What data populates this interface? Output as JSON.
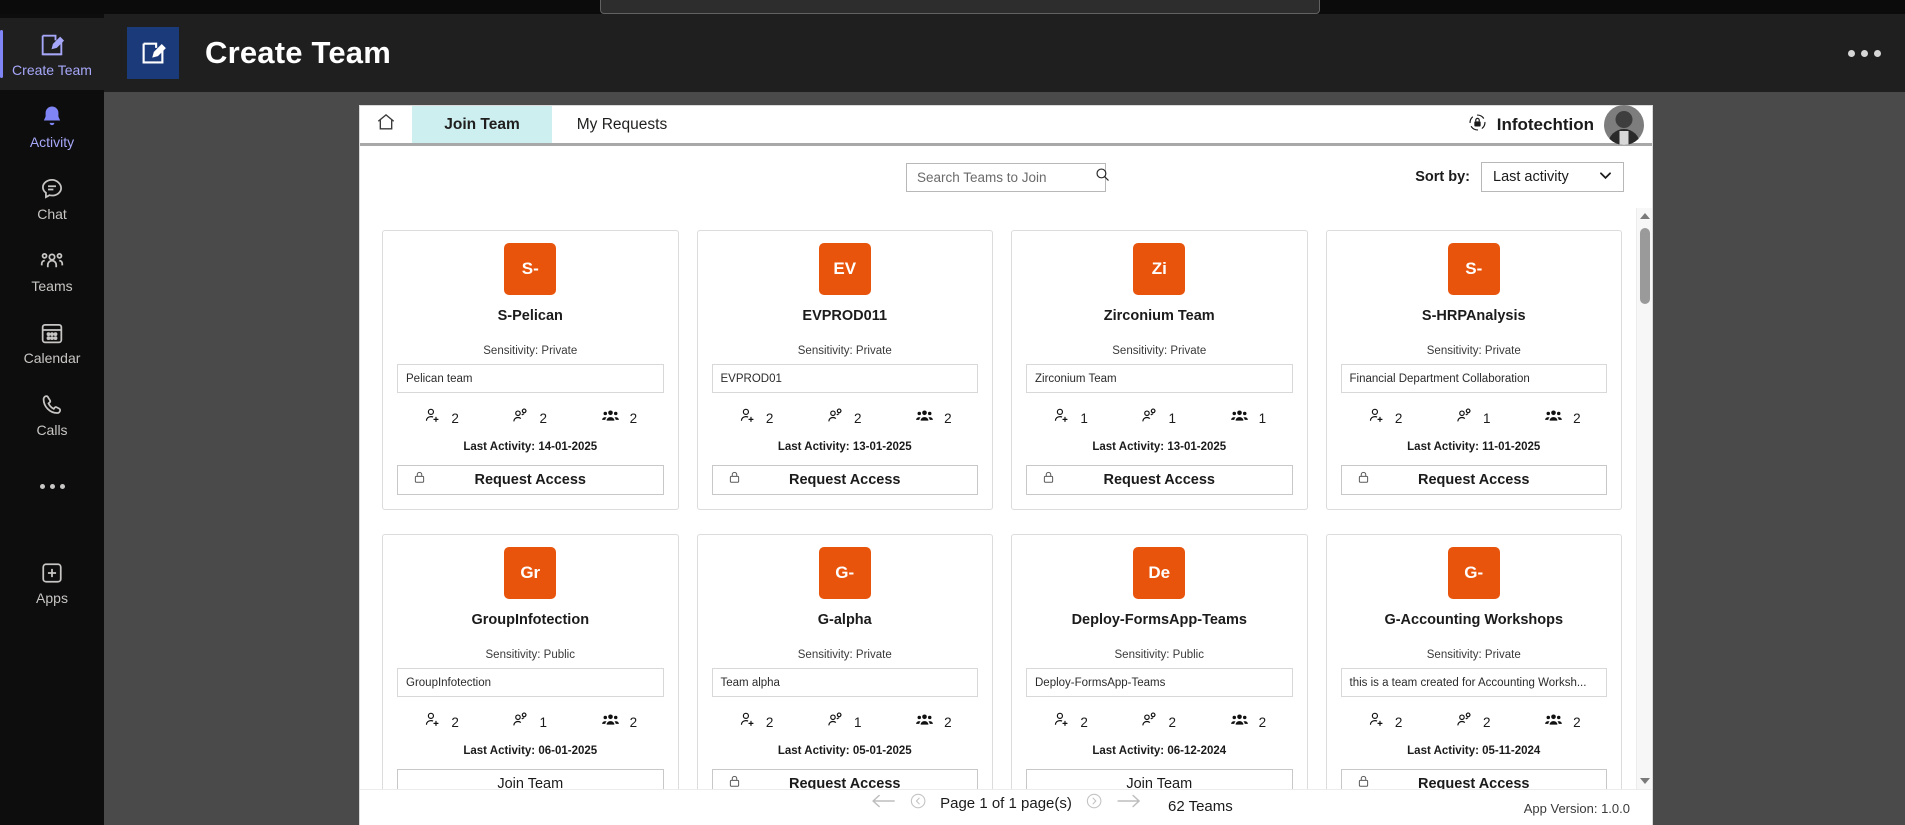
{
  "rail": {
    "items": [
      {
        "label": "Create Team",
        "icon": "compose-icon",
        "state": "active"
      },
      {
        "label": "Activity",
        "icon": "bell-icon",
        "state": "highlight"
      },
      {
        "label": "Chat",
        "icon": "chat-icon",
        "state": "normal"
      },
      {
        "label": "Teams",
        "icon": "teams-icon",
        "state": "normal"
      },
      {
        "label": "Calendar",
        "icon": "calendar-icon",
        "state": "normal"
      },
      {
        "label": "Calls",
        "icon": "phone-icon",
        "state": "normal"
      },
      {
        "label": "",
        "icon": "more-dots-icon",
        "state": "normal"
      },
      {
        "label": "Apps",
        "icon": "apps-plus-icon",
        "state": "normal"
      }
    ]
  },
  "app_header": {
    "title": "Create Team",
    "icon": "compose-app-icon",
    "overflow": "more-options-icon",
    "accent_color": "#1b3a7a"
  },
  "tabs": [
    {
      "label": "Join Team",
      "active": true
    },
    {
      "label": "My Requests",
      "active": false
    }
  ],
  "home_tab_icon": "home-icon",
  "brand": {
    "name": "Infotechtion",
    "icon": "shield-lock-icon",
    "avatar": "user-avatar"
  },
  "toolbar": {
    "search_placeholder": "Search Teams to Join",
    "search_value": "",
    "search_icon": "search-icon",
    "sort_label": "Sort by:",
    "sort_value": "Last activity",
    "sort_options": [
      "Last activity"
    ],
    "sort_icon": "chevron-down-icon"
  },
  "stat_icons": [
    "person-add-icon",
    "person-shared-icon",
    "people-group-icon"
  ],
  "cards": [
    {
      "initials": "S-",
      "name": "S-Pelican",
      "sensitivity": "Sensitivity: Private",
      "description": "Pelican team",
      "stats": [
        "2",
        "2",
        "2"
      ],
      "last_activity": "Last Activity: 14-01-2025",
      "action": "Request Access",
      "locked": true
    },
    {
      "initials": "EV",
      "name": "EVPROD011",
      "sensitivity": "Sensitivity: Private",
      "description": "EVPROD01",
      "stats": [
        "2",
        "2",
        "2"
      ],
      "last_activity": "Last Activity: 13-01-2025",
      "action": "Request Access",
      "locked": true
    },
    {
      "initials": "Zi",
      "name": "Zirconium Team",
      "sensitivity": "Sensitivity: Private",
      "description": "Zirconium Team",
      "stats": [
        "1",
        "1",
        "1"
      ],
      "last_activity": "Last Activity: 13-01-2025",
      "action": "Request Access",
      "locked": true
    },
    {
      "initials": "S-",
      "name": "S-HRPAnalysis",
      "sensitivity": "Sensitivity: Private",
      "description": "Financial Department Collaboration",
      "stats": [
        "2",
        "1",
        "2"
      ],
      "last_activity": "Last Activity: 11-01-2025",
      "action": "Request Access",
      "locked": true
    },
    {
      "initials": "Gr",
      "name": "GroupInfotection",
      "sensitivity": "Sensitivity: Public",
      "description": "GroupInfotection",
      "stats": [
        "2",
        "1",
        "2"
      ],
      "last_activity": "Last Activity: 06-01-2025",
      "action": "Join Team",
      "locked": false
    },
    {
      "initials": "G-",
      "name": "G-alpha",
      "sensitivity": "Sensitivity: Private",
      "description": "Team alpha",
      "stats": [
        "2",
        "1",
        "2"
      ],
      "last_activity": "Last Activity: 05-01-2025",
      "action": "Request Access",
      "locked": true
    },
    {
      "initials": "De",
      "name": "Deploy-FormsApp-Teams",
      "sensitivity": "Sensitivity: Public",
      "description": "Deploy-FormsApp-Teams",
      "stats": [
        "2",
        "2",
        "2"
      ],
      "last_activity": "Last Activity: 06-12-2024",
      "action": "Join Team",
      "locked": false
    },
    {
      "initials": "G-",
      "name": "G-Accounting Workshops",
      "sensitivity": "Sensitivity: Private",
      "description": "this is a team created for Accounting Worksh...",
      "stats": [
        "2",
        "2",
        "2"
      ],
      "last_activity": "Last Activity: 05-11-2024",
      "action": "Request Access",
      "locked": true
    }
  ],
  "footer": {
    "page_text": "Page 1 of 1 page(s)",
    "first_icon": "arrow-first-icon",
    "prev_icon": "chevron-left-circle-icon",
    "next_icon": "chevron-right-circle-icon",
    "last_icon": "arrow-last-icon",
    "team_count": "62 Teams",
    "app_version": "App Version: 1.0.0"
  },
  "colors": {
    "avatar_orange": "#e8540c",
    "tab_active": "#cdeff0",
    "app_icon": "#1b3a7a"
  }
}
